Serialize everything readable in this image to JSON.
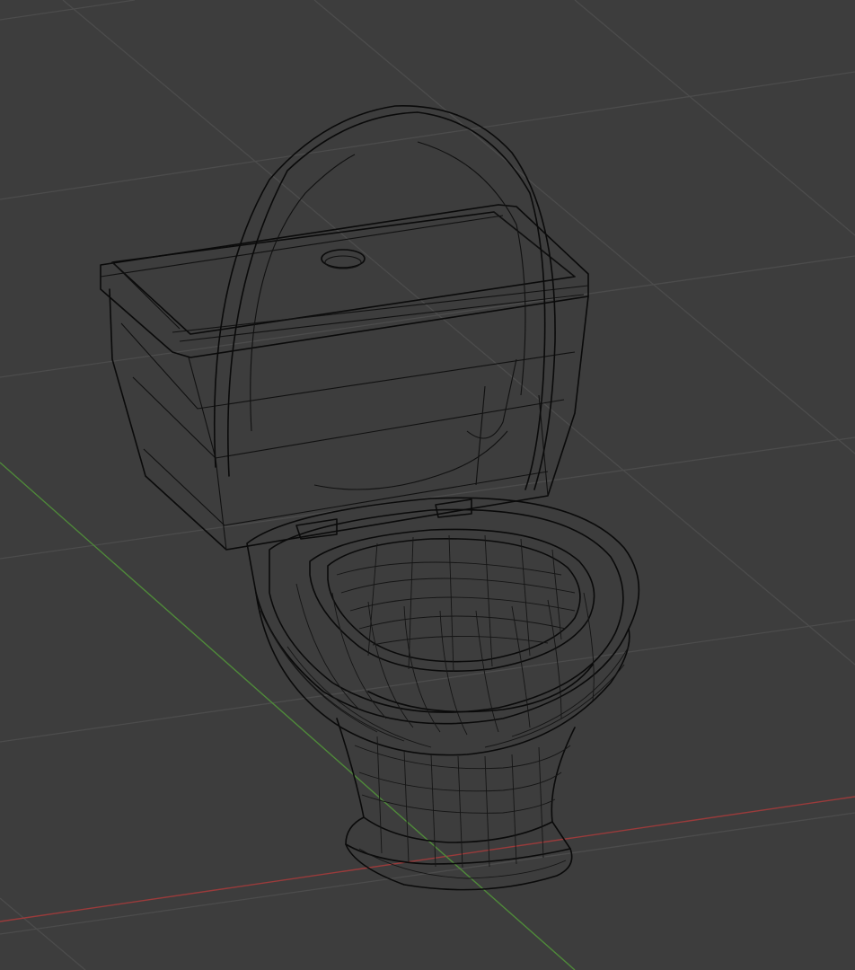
{
  "viewport": {
    "background_color": "#3d3d3d",
    "grid_color": "#4c4c4c",
    "x_axis_color": "#9a3b3b",
    "y_axis_color": "#4f8a3a",
    "wireframe_color": "#0a0a0a",
    "display_mode": "wireframe",
    "object": "toilet-model",
    "icons": {
      "grid": "floor-grid-icon",
      "axis_x": "x-axis-line",
      "axis_y": "y-axis-line"
    }
  }
}
